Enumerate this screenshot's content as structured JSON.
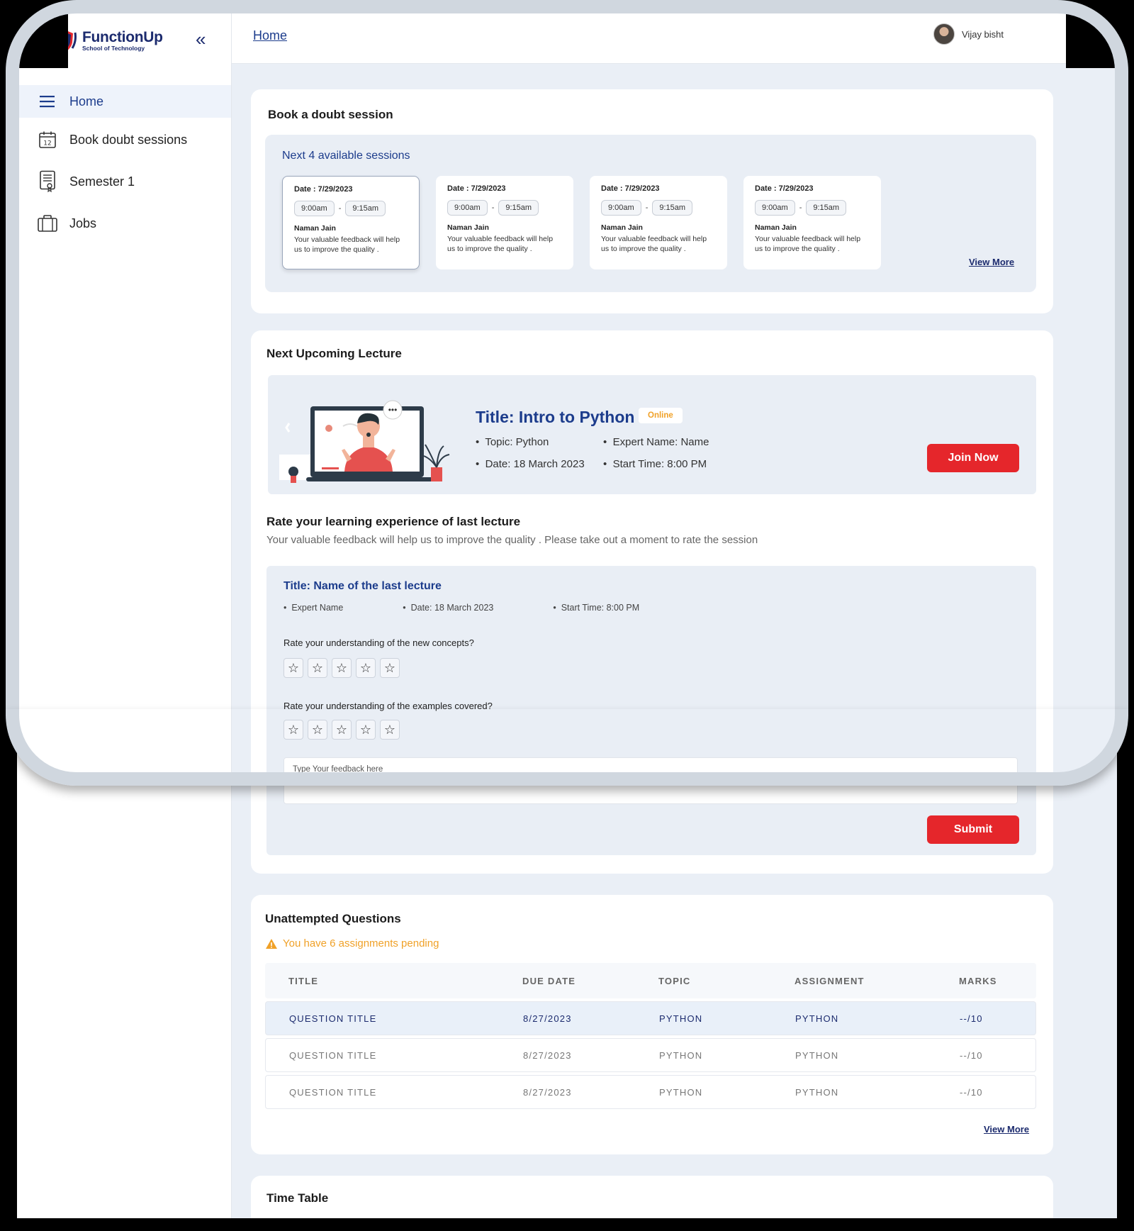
{
  "brand": {
    "name": "FunctionUp",
    "subtitle": "School of Technology"
  },
  "sidebar": {
    "collapse_glyph": "«",
    "items": [
      {
        "label": "Home",
        "icon": "menu-icon",
        "active": true
      },
      {
        "label": "Book doubt sessions",
        "icon": "calendar-icon",
        "calendar_day": "12"
      },
      {
        "label": "Semester 1",
        "icon": "certificate-icon"
      },
      {
        "label": "Jobs",
        "icon": "briefcase-icon"
      }
    ]
  },
  "header": {
    "breadcrumb": "Home",
    "user_name": "Vijay bisht"
  },
  "doubt": {
    "title": "Book a doubt session",
    "subtitle": "Next 4 available sessions",
    "sessions": [
      {
        "date": "Date : 7/29/2023",
        "start": "9:00am",
        "end": "9:15am",
        "sep": "-",
        "name": "Naman Jain",
        "message": "Your valuable feedback will help us to improve the quality ."
      },
      {
        "date": "Date : 7/29/2023",
        "start": "9:00am",
        "end": "9:15am",
        "sep": "-",
        "name": "Naman Jain",
        "message": "Your valuable feedback will help us to improve the quality ."
      },
      {
        "date": "Date : 7/29/2023",
        "start": "9:00am",
        "end": "9:15am",
        "sep": "-",
        "name": "Naman Jain",
        "message": "Your valuable feedback will help us to improve the quality ."
      },
      {
        "date": "Date : 7/29/2023",
        "start": "9:00am",
        "end": "9:15am",
        "sep": "-",
        "name": "Naman Jain",
        "message": "Your valuable feedback will help us to improve the quality ."
      }
    ],
    "view_more": "View More"
  },
  "lecture": {
    "section_title": "Next Upcoming Lecture",
    "title": "Title: Intro to Python",
    "badge": "Online",
    "topic": "Topic: Python",
    "expert": "Expert Name: Name",
    "date": "Date: 18 March 2023",
    "start": "Start Time: 8:00 PM",
    "join_label": "Join Now",
    "illustration_dots": "•••"
  },
  "rating": {
    "title": "Rate your learning experience of last lecture",
    "description": "Your valuable feedback will help us to improve the quality . Please take out a moment to rate the session",
    "lecture_title": "Title: Name of the last lecture",
    "expert": "Expert Name",
    "date": "Date: 18 March 2023",
    "start": "Start Time: 8:00 PM",
    "q1": "Rate your understanding of the new concepts?",
    "q2": "Rate your understanding of the examples covered?",
    "q1_rating": 0,
    "q2_rating": 0,
    "max_rating": 5,
    "star_glyph": "☆",
    "feedback_placeholder": "Type Your feedback here",
    "submit_label": "Submit"
  },
  "questions": {
    "title": "Unattempted Questions",
    "warning": "You have 6 assignments pending",
    "columns": [
      "TITLE",
      "DUE DATE",
      "TOPIC",
      "ASSIGNMENT",
      "MARKS"
    ],
    "rows": [
      [
        "QUESTION TITLE",
        "8/27/2023",
        "PYTHON",
        "PYTHON",
        "--/10"
      ],
      [
        "QUESTION TITLE",
        "8/27/2023",
        "PYTHON",
        "PYTHON",
        "--/10"
      ],
      [
        "QUESTION TITLE",
        "8/27/2023",
        "PYTHON",
        "PYTHON",
        "--/10"
      ]
    ],
    "view_more": "View More"
  },
  "timetable": {
    "title": "Time Table"
  },
  "colors": {
    "brand_navy": "#1c2b6e",
    "accent_blue": "#1c3c8c",
    "danger_red": "#e5262b",
    "warning_orange": "#f0a128",
    "panel_bg": "#e9eef5"
  }
}
